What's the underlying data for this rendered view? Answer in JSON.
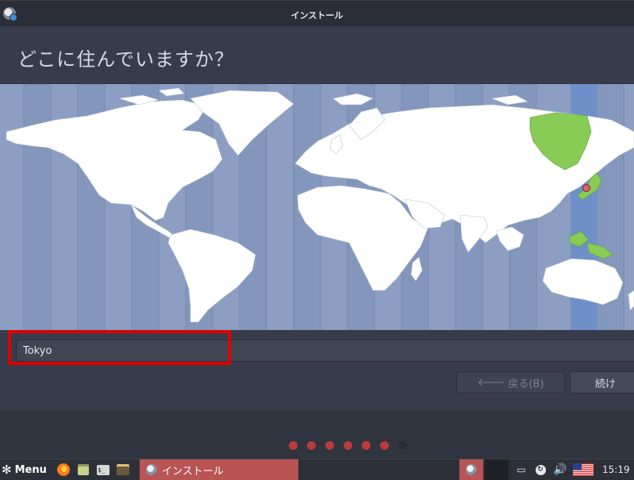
{
  "window": {
    "title": "インストール",
    "icon": "installer-disc-icon"
  },
  "page": {
    "heading": "どこに住んでいますか？"
  },
  "map": {
    "selected_timezone": "Asia/Tokyo",
    "colors": {
      "ocean": "#8c9fc2",
      "zone_alt": "#7f92b8",
      "land": "#ffffff",
      "selected_band": "#6f8fc9",
      "selected_land": "#88cc55",
      "marker": "#e06070"
    }
  },
  "search": {
    "value": "Tokyo"
  },
  "buttons": {
    "back_label": "戻る(B)",
    "back_icon": "arrow-left-icon",
    "next_label": "続け"
  },
  "progress": {
    "total_steps": 7,
    "completed_steps": 6
  },
  "taskbar": {
    "menu_label": "Menu",
    "launchers": [
      "firefox-icon",
      "files-icon",
      "terminal-icon",
      "media-icon"
    ],
    "active_task_label": "インストール",
    "clock": "15:19"
  },
  "colors": {
    "accent": "#b85454",
    "highlight": "#e00000",
    "background": "#2f343f"
  }
}
